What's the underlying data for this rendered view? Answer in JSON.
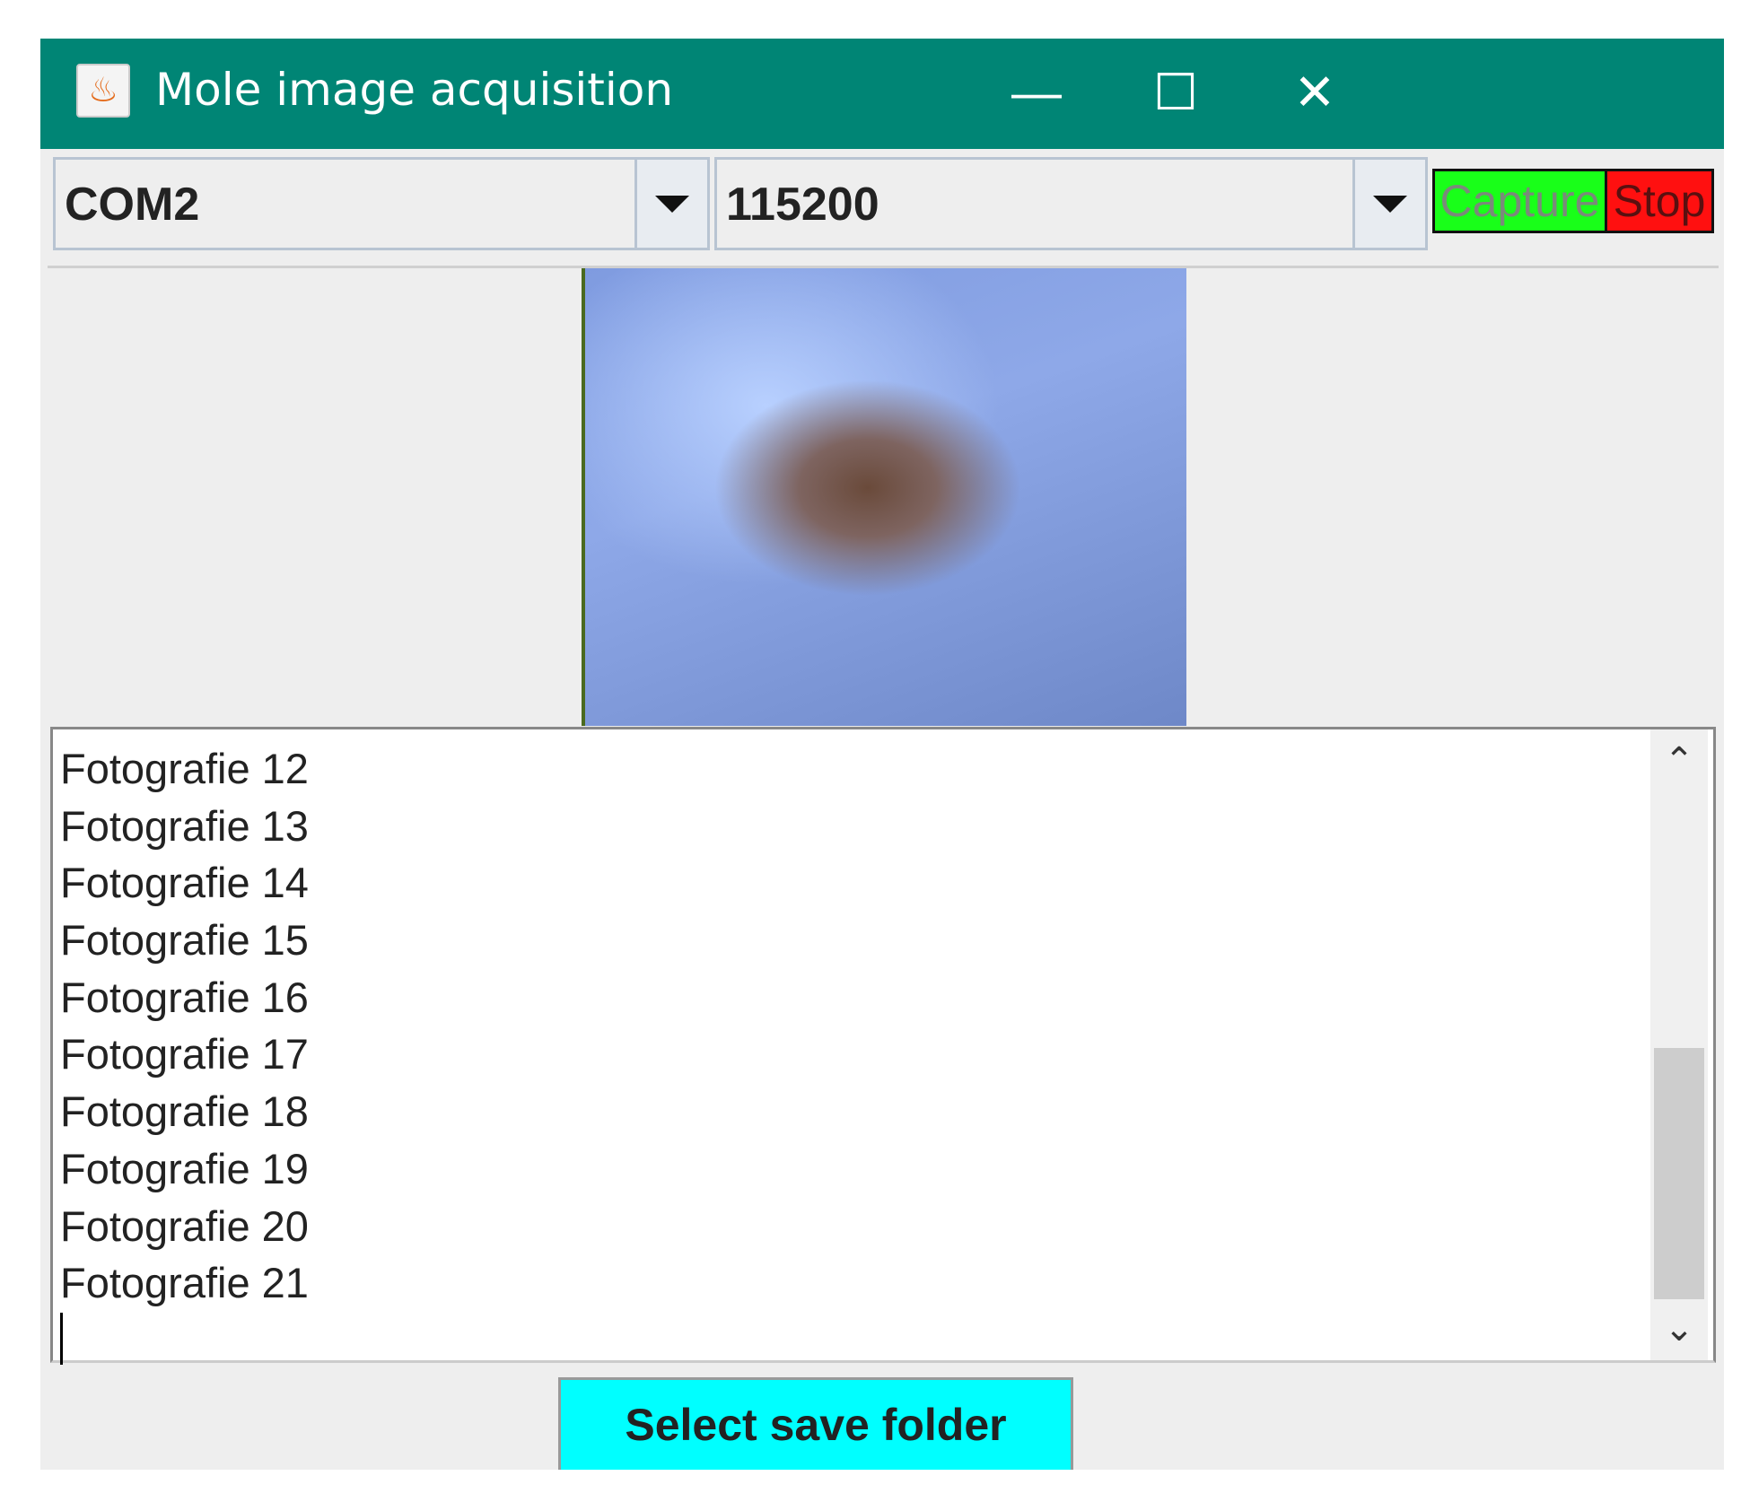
{
  "window": {
    "title": "Mole image acquisition",
    "minimize": "—",
    "maximize": "☐",
    "close": "✕",
    "app_icon": "java-icon"
  },
  "toolbar": {
    "port": {
      "value": "COM2"
    },
    "baud": {
      "value": "115200"
    },
    "capture_label": "Capture",
    "stop_label": "Stop",
    "colors": {
      "capture": "#19ff19",
      "stop": "#ff1010"
    }
  },
  "log": {
    "lines": [
      "Fotografie 12",
      "Fotografie 13",
      "Fotografie 14",
      "Fotografie 15",
      "Fotografie 16",
      "Fotografie 17",
      "Fotografie 18",
      "Fotografie 19",
      "Fotografie 20",
      "Fotografie 21"
    ],
    "scroll_up": "⌃",
    "scroll_down": "⌄"
  },
  "footer": {
    "select_folder_label": "Select save folder"
  },
  "colors": {
    "titlebar": "#008575",
    "folder_button": "#00ffff"
  }
}
